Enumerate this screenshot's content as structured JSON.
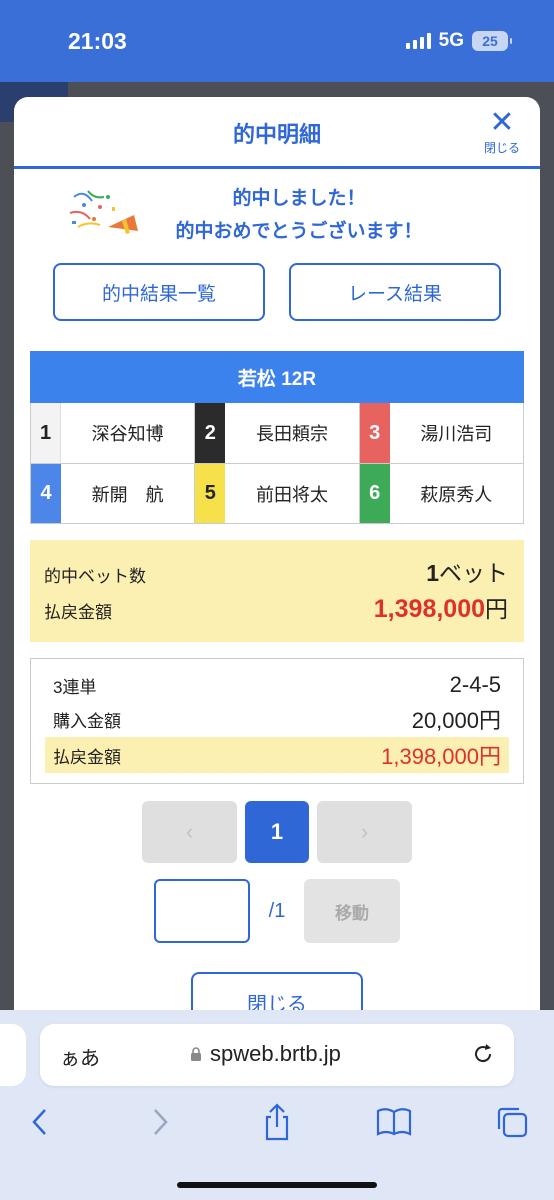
{
  "status_bar": {
    "time": "21:03",
    "network": "5G",
    "battery": "25"
  },
  "modal": {
    "title": "的中明細",
    "close_label": "閉じる",
    "congrats_line1": "的中しました！",
    "congrats_line2": "的中おめでとうございます！",
    "btn_hit_list": "的中結果一覧",
    "btn_race_result": "レース結果",
    "race_title": "若松 12R",
    "racers": [
      {
        "lane": "1",
        "name": "深谷知博"
      },
      {
        "lane": "2",
        "name": "長田頼宗"
      },
      {
        "lane": "3",
        "name": "湯川浩司"
      },
      {
        "lane": "4",
        "name": "新開　航"
      },
      {
        "lane": "5",
        "name": "前田将太"
      },
      {
        "lane": "6",
        "name": "萩原秀人"
      }
    ],
    "summary": {
      "hit_bets_label": "的中ベット数",
      "hit_bets_count": "1",
      "hit_bets_unit": "ベット",
      "payout_label": "払戻金額",
      "payout_value": "1,398,000",
      "yen": "円"
    },
    "detail": {
      "bet_type": "3連単",
      "combination": "2-4-5",
      "purchase_label": "購入金額",
      "purchase_value": "20,000円",
      "payout_label": "払戻金額",
      "payout_value": "1,398,000円"
    },
    "pager": {
      "prev": "‹",
      "current": "1",
      "next": "›",
      "total": "/1",
      "jump_label": "移動",
      "jump_value": ""
    },
    "bottom_close": "閉じる"
  },
  "browser": {
    "text_size": "ぁあ",
    "url": "spweb.brtb.jp"
  },
  "colors": {
    "accent": "#2f68d6",
    "race_header": "#3c82ec",
    "highlight": "#fbefb1",
    "payout_red": "#e0302b",
    "lane_colors": [
      "#f3f3f3",
      "#2b2b2b",
      "#e7635f",
      "#4b86e8",
      "#f6e14a",
      "#3daa58"
    ]
  }
}
